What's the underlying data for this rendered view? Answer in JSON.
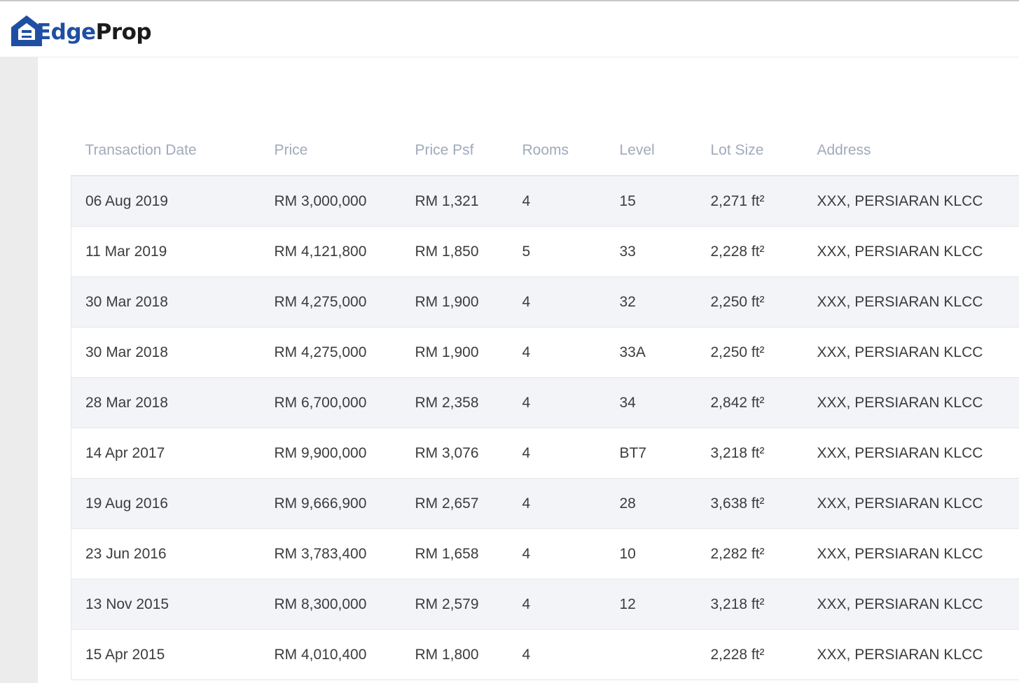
{
  "brand": {
    "logo_part1": "Edge",
    "logo_part2": "Prop",
    "primary_color": "#1f4fa3"
  },
  "table": {
    "headers": [
      "Transaction Date",
      "Price",
      "Price Psf",
      "Rooms",
      "Level",
      "Lot Size",
      "Address"
    ],
    "rows": [
      [
        "06 Aug 2019",
        "RM 3,000,000",
        "RM 1,321",
        "4",
        "15",
        "2,271 ft²",
        "XXX, PERSIARAN KLCC"
      ],
      [
        "11 Mar 2019",
        "RM 4,121,800",
        "RM 1,850",
        "5",
        "33",
        "2,228 ft²",
        "XXX, PERSIARAN KLCC"
      ],
      [
        "30 Mar 2018",
        "RM 4,275,000",
        "RM 1,900",
        "4",
        "32",
        "2,250 ft²",
        "XXX, PERSIARAN KLCC"
      ],
      [
        "30 Mar 2018",
        "RM 4,275,000",
        "RM 1,900",
        "4",
        "33A",
        "2,250 ft²",
        "XXX, PERSIARAN KLCC"
      ],
      [
        "28 Mar 2018",
        "RM 6,700,000",
        "RM 2,358",
        "4",
        "34",
        "2,842 ft²",
        "XXX, PERSIARAN KLCC"
      ],
      [
        "14 Apr 2017",
        "RM 9,900,000",
        "RM 3,076",
        "4",
        "BT7",
        "3,218 ft²",
        "XXX, PERSIARAN KLCC"
      ],
      [
        "19 Aug 2016",
        "RM 9,666,900",
        "RM 2,657",
        "4",
        "28",
        "3,638 ft²",
        "XXX, PERSIARAN KLCC"
      ],
      [
        "23 Jun 2016",
        "RM 3,783,400",
        "RM 1,658",
        "4",
        "10",
        "2,282 ft²",
        "XXX, PERSIARAN KLCC"
      ],
      [
        "13 Nov 2015",
        "RM 8,300,000",
        "RM 2,579",
        "4",
        "12",
        "3,218 ft²",
        "XXX, PERSIARAN KLCC"
      ],
      [
        "15 Apr 2015",
        "RM 4,010,400",
        "RM 1,800",
        "4",
        "",
        "2,228 ft²",
        "XXX, PERSIARAN KLCC"
      ]
    ]
  }
}
